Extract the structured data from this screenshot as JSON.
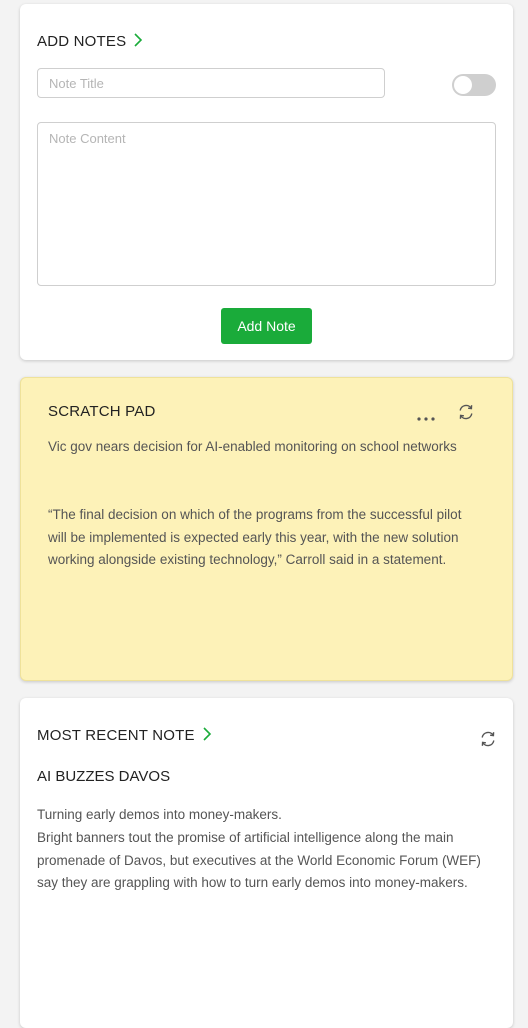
{
  "add_notes": {
    "title": "ADD NOTES",
    "title_placeholder": "Note Title",
    "content_placeholder": "Note Content",
    "button_label": "Add Note",
    "toggle_on": false
  },
  "scratch_pad": {
    "title": "SCRATCH PAD",
    "paragraphs": [
      "Vic gov nears decision for AI-enabled monitoring on school networks",
      "“The final decision on which of the programs from the successful pilot will be implemented is expected early this year, with the new solution working alongside existing technology,” Carroll said in a statement."
    ]
  },
  "recent_note": {
    "title": "MOST RECENT NOTE",
    "note_title": "AI BUZZES DAVOS",
    "lines": [
      "Turning early demos into money-makers.",
      "Bright banners tout the promise of artificial intelligence along the main promenade of Davos, but executives at the World Economic Forum (WEF) say they are grappling with how to turn early demos into money-makers."
    ]
  },
  "colors": {
    "accent_green": "#1aab3a",
    "scratch_bg": "#fdf2b8",
    "page_bg": "#f3f3f3"
  },
  "icons": [
    "chevron-right-icon",
    "more-horizontal-icon",
    "refresh-icon"
  ]
}
